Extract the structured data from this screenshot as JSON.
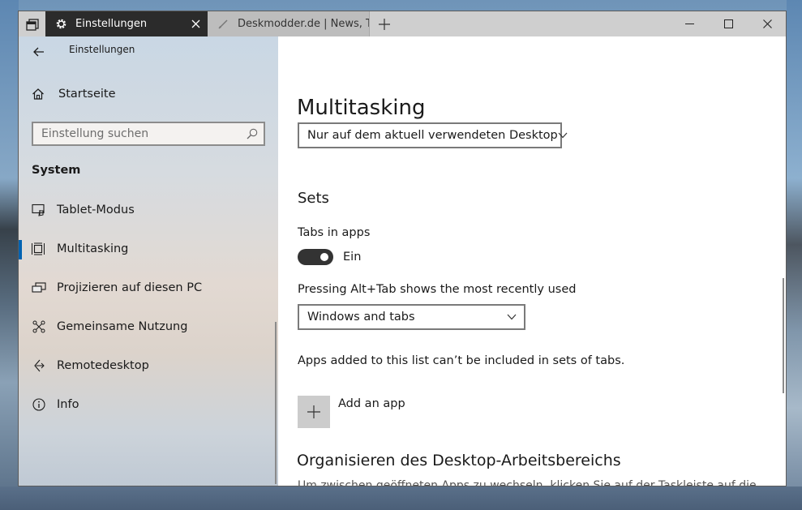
{
  "titlebar": {
    "active_tab_label": "Einstellungen",
    "inactive_tab_label": "Deskmodder.de | News, Tipps",
    "new_tab_symbol": "+"
  },
  "sidebar": {
    "app_title": "Einstellungen",
    "home_label": "Startseite",
    "search_placeholder": "Einstellung suchen",
    "section_heading": "System",
    "items": [
      {
        "label": "Tablet-Modus",
        "icon": "tablet-mode-icon"
      },
      {
        "label": "Multitasking",
        "icon": "multitasking-icon"
      },
      {
        "label": "Projizieren auf diesen PC",
        "icon": "project-icon"
      },
      {
        "label": "Gemeinsame Nutzung",
        "icon": "share-icon"
      },
      {
        "label": "Remotedesktop",
        "icon": "remote-desktop-icon"
      },
      {
        "label": "Info",
        "icon": "info-icon"
      }
    ],
    "selected_index": 1
  },
  "main": {
    "page_title": "Multitasking",
    "desktop_dropdown_value": "Nur auf dem aktuell verwendeten Desktop",
    "sets_heading": "Sets",
    "tabs_in_apps_label": "Tabs in apps",
    "tabs_in_apps_state": "Ein",
    "alttab_label": "Pressing Alt+Tab shows the most recently used",
    "alttab_dropdown_value": "Windows and tabs",
    "apps_note": "Apps added to this list can’t be included in sets of tabs.",
    "add_app_label": "Add an app",
    "org_heading": "Organisieren des Desktop-Arbeitsbereichs",
    "org_description": "Um zwischen geöffneten Apps zu wechseln, klicken Sie auf der Taskleiste auf die"
  },
  "colors": {
    "accent": "#0063b1",
    "active_tab_bg": "#2b2b2b",
    "toggle_on": "#333333"
  }
}
